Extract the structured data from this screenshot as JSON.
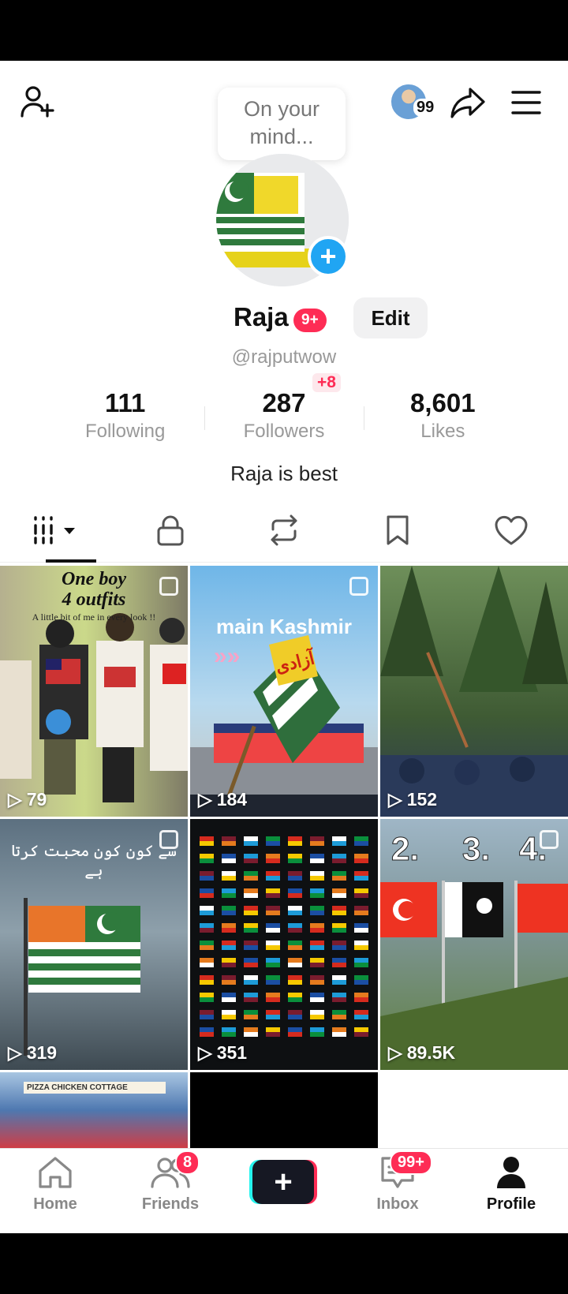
{
  "header": {
    "thought_bubble": "On your mind...",
    "visitor_count": "99"
  },
  "profile": {
    "name": "Raja",
    "name_badge": "9+",
    "edit_label": "Edit",
    "handle": "@rajputwow",
    "new_followers": "+8",
    "bio": "Raja is best"
  },
  "stats": [
    {
      "value": "111",
      "label": "Following"
    },
    {
      "value": "287",
      "label": "Followers"
    },
    {
      "value": "8,601",
      "label": "Likes"
    }
  ],
  "tabs": [
    "grid-icon",
    "lock-icon",
    "repost-icon",
    "bookmark-icon",
    "heart-icon"
  ],
  "videos": [
    {
      "views": "79",
      "title_line1": "One boy",
      "title_line2": "4 outfits",
      "subtitle": "A little bit of me in every look !!"
    },
    {
      "views": "184",
      "caption": "main Kashmir",
      "flag_text": "آزادی"
    },
    {
      "views": "152"
    },
    {
      "views": "319",
      "caption": "سے کون کون محبت کرتا ہے"
    },
    {
      "views": "351"
    },
    {
      "views": "89.5K",
      "numbers": [
        "2.",
        "3.",
        "4."
      ]
    },
    {
      "views": "",
      "sign": "PIZZA  CHICKEN COTTAGE"
    },
    {
      "views": ""
    },
    {
      "views": ""
    }
  ],
  "nav": {
    "home": "Home",
    "friends": "Friends",
    "friends_badge": "8",
    "inbox": "Inbox",
    "inbox_badge": "99+",
    "profile": "Profile"
  }
}
